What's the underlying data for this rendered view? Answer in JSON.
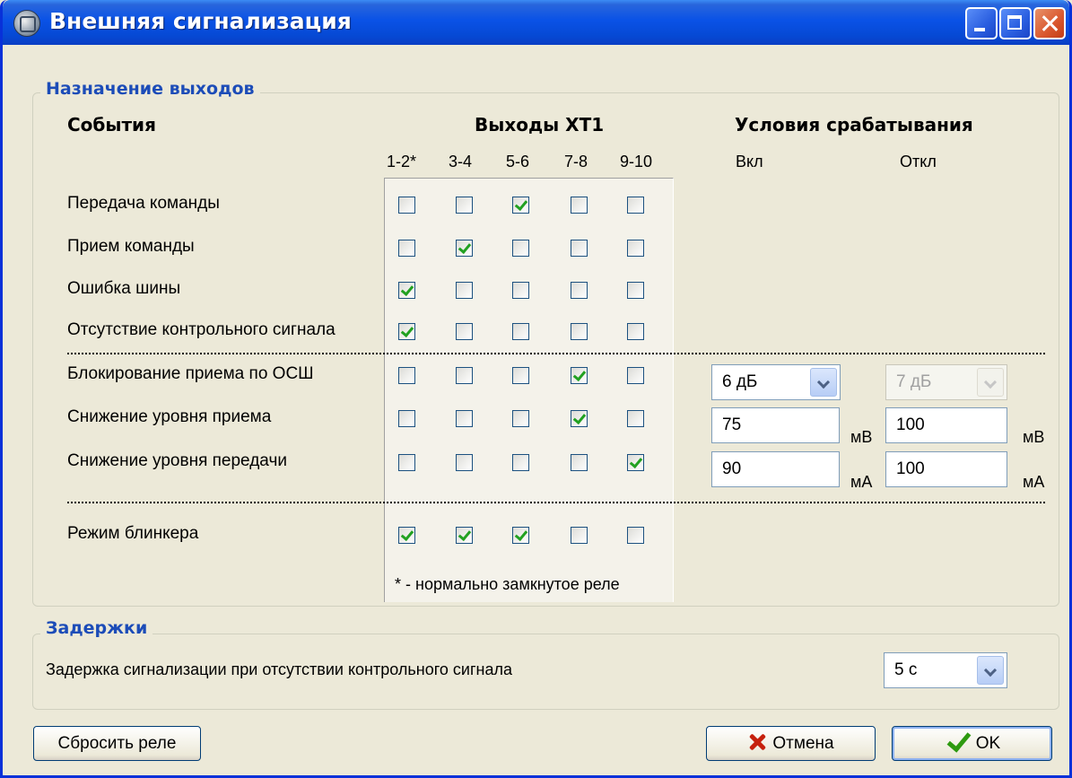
{
  "window": {
    "title": "Внешняя сигнализация"
  },
  "outputs": {
    "legend": "Назначение выходов",
    "events_header": "События",
    "outputs_header": "Выходы XT1",
    "conditions_header": "Условия срабатывания",
    "columns": [
      "1-2*",
      "3-4",
      "5-6",
      "7-8",
      "9-10"
    ],
    "on_label": "Вкл",
    "off_label": "Откл",
    "rows": [
      {
        "label": "Передача команды",
        "checks": [
          false,
          false,
          true,
          false,
          false
        ]
      },
      {
        "label": "Прием команды",
        "checks": [
          false,
          true,
          false,
          false,
          false
        ]
      },
      {
        "label": "Ошибка шины",
        "checks": [
          true,
          false,
          false,
          false,
          false
        ]
      },
      {
        "label": "Отсутствие контрольного сигнала",
        "checks": [
          true,
          false,
          false,
          false,
          false
        ]
      },
      {
        "label": "Блокирование приема по ОСШ",
        "checks": [
          false,
          false,
          false,
          true,
          false
        ]
      },
      {
        "label": "Снижение уровня приема",
        "checks": [
          false,
          false,
          false,
          true,
          false
        ]
      },
      {
        "label": "Снижение уровня передачи",
        "checks": [
          false,
          false,
          false,
          false,
          true
        ]
      },
      {
        "label": "Режим блинкера",
        "checks": [
          true,
          true,
          true,
          false,
          false
        ]
      }
    ],
    "conditions": {
      "snr_on": "6 дБ",
      "snr_off": "7 дБ",
      "rx_on": "75",
      "rx_on_unit": "мВ",
      "rx_off": "100",
      "rx_off_unit": "мВ",
      "tx_on": "90",
      "tx_on_unit": "мА",
      "tx_off": "100",
      "tx_off_unit": "мА"
    },
    "footnote": "* - нормально замкнутое реле"
  },
  "delays": {
    "legend": "Задержки",
    "label": "Задержка сигнализации при отсутствии контрольного сигнала",
    "value": "5 с"
  },
  "buttons": {
    "reset": "Сбросить реле",
    "cancel": "Отмена",
    "ok": "OK"
  }
}
